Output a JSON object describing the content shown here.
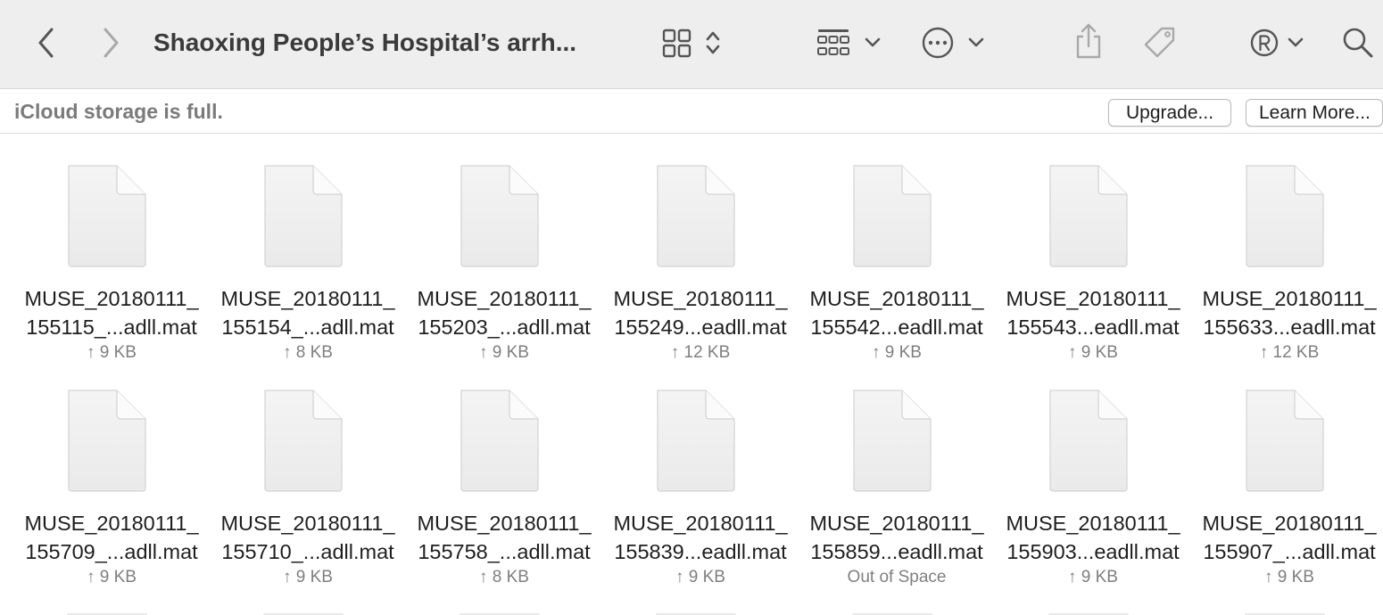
{
  "window": {
    "title": "Shaoxing People’s Hospital’s arrh..."
  },
  "toolbar": {
    "icons": [
      "chevron-left-icon",
      "chevron-right-icon",
      "grid-view-icon",
      "group-by-icon",
      "more-actions-icon",
      "share-icon",
      "tag-icon",
      "registered-icon",
      "search-icon"
    ]
  },
  "banner": {
    "message": "iCloud storage is full.",
    "upgrade_label": "Upgrade...",
    "learn_more_label": "Learn More..."
  },
  "files": [
    {
      "line1": "MUSE_20180111_",
      "line2": "155115_...adll.mat",
      "status": "↑ 9 KB"
    },
    {
      "line1": "MUSE_20180111_",
      "line2": "155154_...adll.mat",
      "status": "↑ 8 KB"
    },
    {
      "line1": "MUSE_20180111_",
      "line2": "155203_...adll.mat",
      "status": "↑ 9 KB"
    },
    {
      "line1": "MUSE_20180111_",
      "line2": "155249...eadll.mat",
      "status": "↑ 12 KB"
    },
    {
      "line1": "MUSE_20180111_",
      "line2": "155542...eadll.mat",
      "status": "↑ 9 KB"
    },
    {
      "line1": "MUSE_20180111_",
      "line2": "155543...eadll.mat",
      "status": "↑ 9 KB"
    },
    {
      "line1": "MUSE_20180111_",
      "line2": "155633...eadll.mat",
      "status": "↑ 12 KB"
    },
    {
      "line1": "MUSE_20180111_",
      "line2": "155709_...adll.mat",
      "status": "↑ 9 KB"
    },
    {
      "line1": "MUSE_20180111_",
      "line2": "155710_...adll.mat",
      "status": "↑ 9 KB"
    },
    {
      "line1": "MUSE_20180111_",
      "line2": "155758_...adll.mat",
      "status": "↑ 8 KB"
    },
    {
      "line1": "MUSE_20180111_",
      "line2": "155839...eadll.mat",
      "status": "↑ 9 KB"
    },
    {
      "line1": "MUSE_20180111_",
      "line2": "155859...eadll.mat",
      "status": "Out of Space"
    },
    {
      "line1": "MUSE_20180111_",
      "line2": "155903...eadll.mat",
      "status": "↑ 9 KB"
    },
    {
      "line1": "MUSE_20180111_",
      "line2": "155907_...adll.mat",
      "status": "↑ 9 KB"
    }
  ]
}
